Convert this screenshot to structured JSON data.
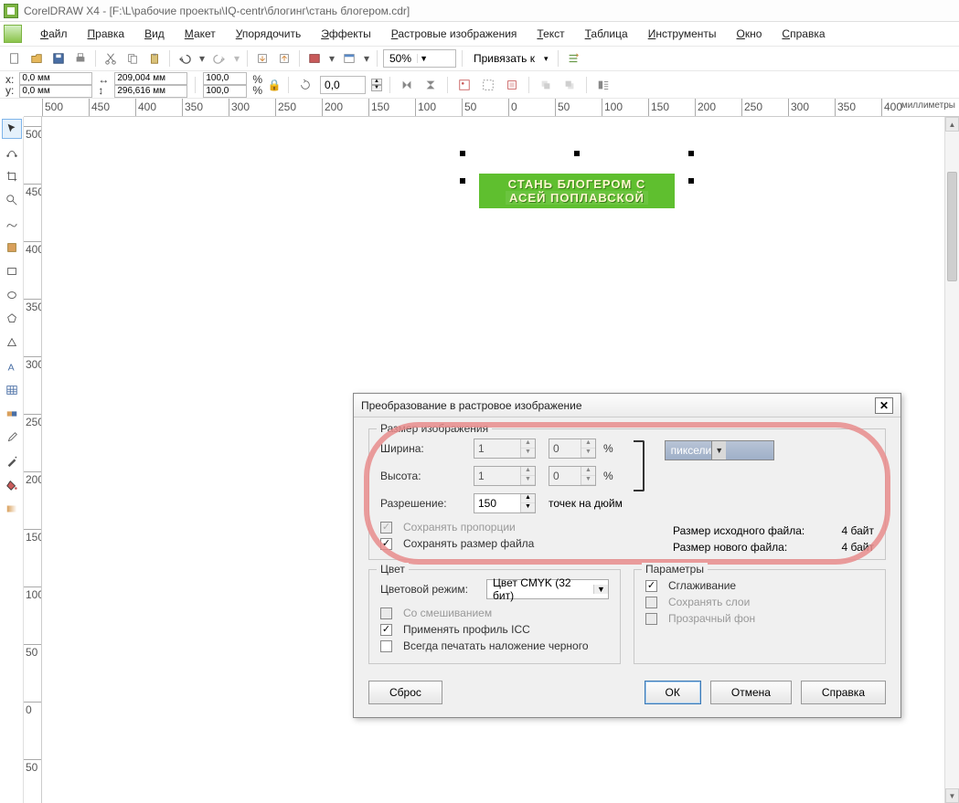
{
  "titlebar": {
    "text": "CorelDRAW X4 - [F:\\L\\рабочие проекты\\IQ-centr\\блогинг\\стань блогером.cdr]"
  },
  "menu": {
    "file": "Файл",
    "edit": "Правка",
    "view": "Вид",
    "layout": "Макет",
    "arrange": "Упорядочить",
    "effects": "Эффекты",
    "bitmaps": "Растровые изображения",
    "text": "Текст",
    "table": "Таблица",
    "tools": "Инструменты",
    "window": "Окно",
    "help": "Справка"
  },
  "maintoolbar": {
    "zoom": "50%",
    "snap_label": "Привязать к",
    "snap_arrow": "▾"
  },
  "props": {
    "x_label": "x:",
    "x_val": "0,0 мм",
    "y_label": "y:",
    "y_val": "0,0 мм",
    "w_val": "209,004 мм",
    "h_val": "296,616 мм",
    "sx": "100,0",
    "sy": "100,0",
    "pct": "%",
    "rot": "0,0"
  },
  "ruler": {
    "unit": "миллиметры",
    "h_ticks": [
      -500,
      -450,
      -400,
      -350,
      -300,
      -250,
      -200,
      -150,
      -100,
      -50,
      0,
      50,
      100,
      150,
      200,
      250,
      300,
      350,
      400
    ],
    "v_ticks": [
      500,
      450,
      400,
      350,
      300,
      250,
      200,
      150,
      100,
      50,
      0,
      -50
    ]
  },
  "banner": {
    "line1": "СТАНЬ БЛОГЕРОМ С",
    "line2": "АСЕЙ ПОПЛАВСКОЙ"
  },
  "dialog": {
    "title": "Преобразование в растровое изображение",
    "grp_size": "Размер изображения",
    "width_lbl": "Ширина:",
    "width_val": "1",
    "width_pct": "0",
    "height_lbl": "Высота:",
    "height_val": "1",
    "height_pct": "0",
    "res_lbl": "Разрешение:",
    "res_val": "150",
    "res_unit": "точек на дюйм",
    "unit_sel": "пиксели",
    "keep_ratio": "Сохранять пропорции",
    "keep_size": "Сохранять размер файла",
    "src_size_lbl": "Размер исходного файла:",
    "src_size_val": "4 байт",
    "new_size_lbl": "Размер нового файла:",
    "new_size_val": "4 байт",
    "grp_color": "Цвет",
    "color_mode_lbl": "Цветовой режим:",
    "color_mode_val": "Цвет CMYK (32 бит)",
    "dither": "Со смешиванием",
    "icc": "Применять профиль ICC",
    "black": "Всегда печатать наложение черного",
    "grp_params": "Параметры",
    "aa": "Сглаживание",
    "layers": "Сохранять слои",
    "transp": "Прозрачный фон",
    "reset": "Сброс",
    "ok": "ОК",
    "cancel": "Отмена",
    "help": "Справка"
  }
}
